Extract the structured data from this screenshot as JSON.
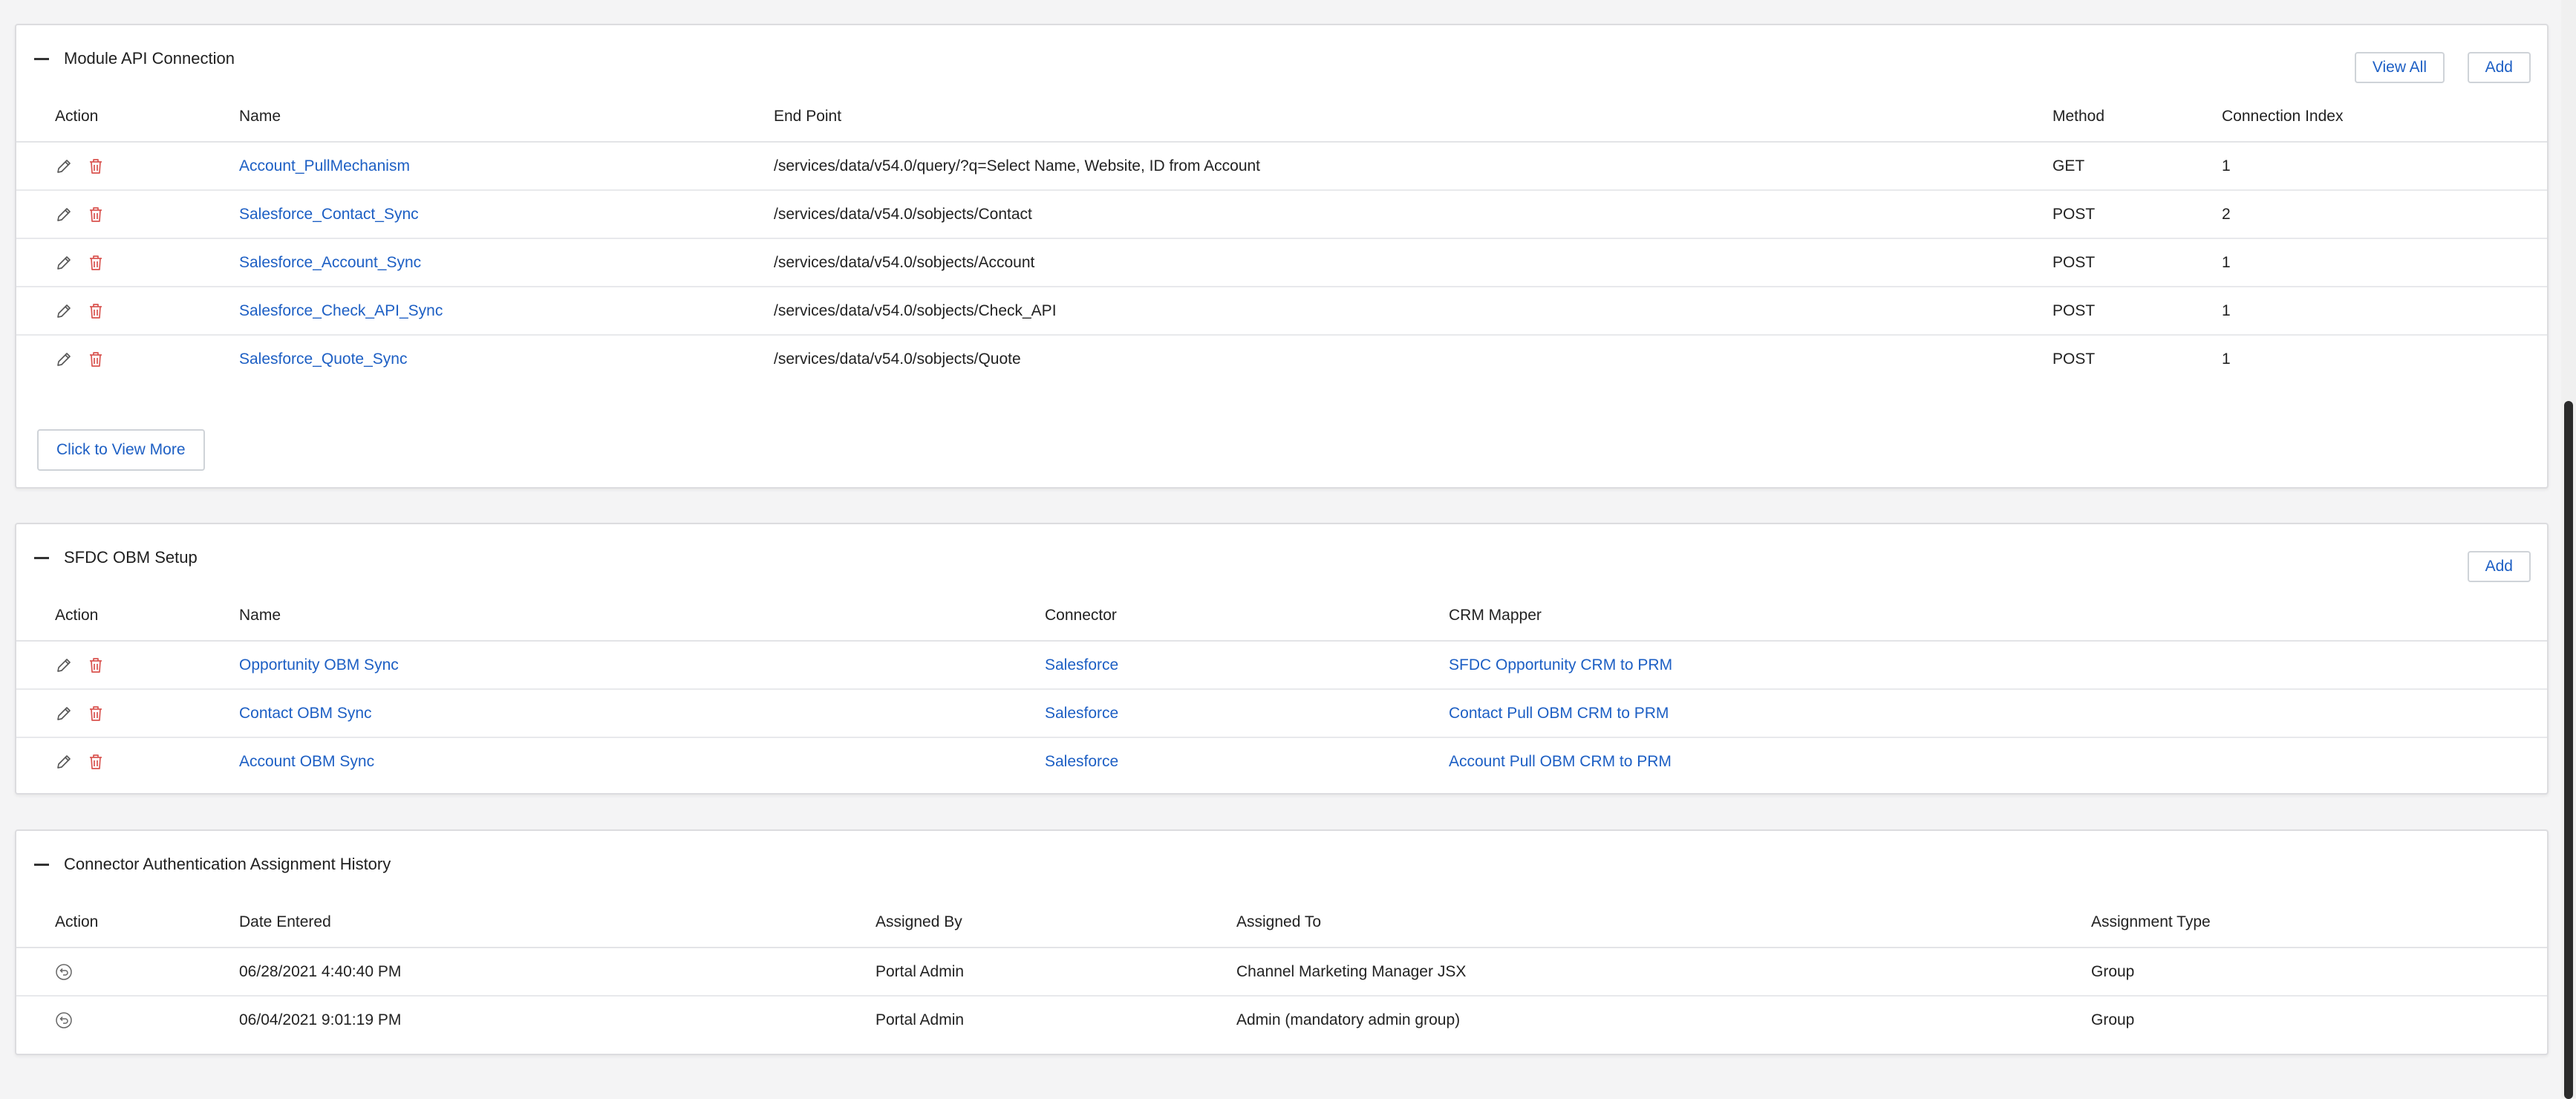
{
  "api_panel": {
    "title": "Module API Connection",
    "view_all_label": "View All",
    "add_label": "Add",
    "columns": [
      "Action",
      "Name",
      "End Point",
      "Method",
      "Connection Index"
    ],
    "rows": [
      {
        "name": "Account_PullMechanism",
        "endpoint": "/services/data/v54.0/query/?q=Select Name, Website, ID from Account",
        "method": "GET",
        "index": "1"
      },
      {
        "name": "Salesforce_Contact_Sync",
        "endpoint": "/services/data/v54.0/sobjects/Contact",
        "method": "POST",
        "index": "2"
      },
      {
        "name": "Salesforce_Account_Sync",
        "endpoint": "/services/data/v54.0/sobjects/Account",
        "method": "POST",
        "index": "1"
      },
      {
        "name": "Salesforce_Check_API_Sync",
        "endpoint": "/services/data/v54.0/sobjects/Check_API",
        "method": "POST",
        "index": "1"
      },
      {
        "name": "Salesforce_Quote_Sync",
        "endpoint": "/services/data/v54.0/sobjects/Quote",
        "method": "POST",
        "index": "1"
      }
    ],
    "view_more_label": "Click to View More"
  },
  "obm_panel": {
    "title": "SFDC OBM Setup",
    "add_label": "Add",
    "columns": [
      "Action",
      "Name",
      "Connector",
      "CRM Mapper"
    ],
    "rows": [
      {
        "name": "Opportunity OBM Sync",
        "connector": "Salesforce",
        "mapper": "SFDC Opportunity CRM to PRM"
      },
      {
        "name": "Contact OBM Sync",
        "connector": "Salesforce",
        "mapper": "Contact Pull OBM CRM to PRM"
      },
      {
        "name": "Account OBM Sync",
        "connector": "Salesforce",
        "mapper": "Account Pull OBM CRM to PRM"
      }
    ]
  },
  "history_panel": {
    "title": "Connector Authentication Assignment History",
    "columns": [
      "Action",
      "Date Entered",
      "Assigned By",
      "Assigned To",
      "Assignment Type"
    ],
    "rows": [
      {
        "date": "06/28/2021 4:40:40 PM",
        "by": "Portal Admin",
        "to": "Channel Marketing Manager JSX",
        "type": "Group"
      },
      {
        "date": "06/04/2021 9:01:19 PM",
        "by": "Portal Admin",
        "to": "Admin (mandatory admin group)",
        "type": "Group"
      }
    ]
  },
  "colors": {
    "link": "#1d5fc4",
    "delete": "#d9534f",
    "edit": "#555555"
  },
  "icons": {
    "edit": "pencil-icon",
    "delete": "trash-icon",
    "revert": "revert-icon",
    "collapse": "minus-icon"
  }
}
